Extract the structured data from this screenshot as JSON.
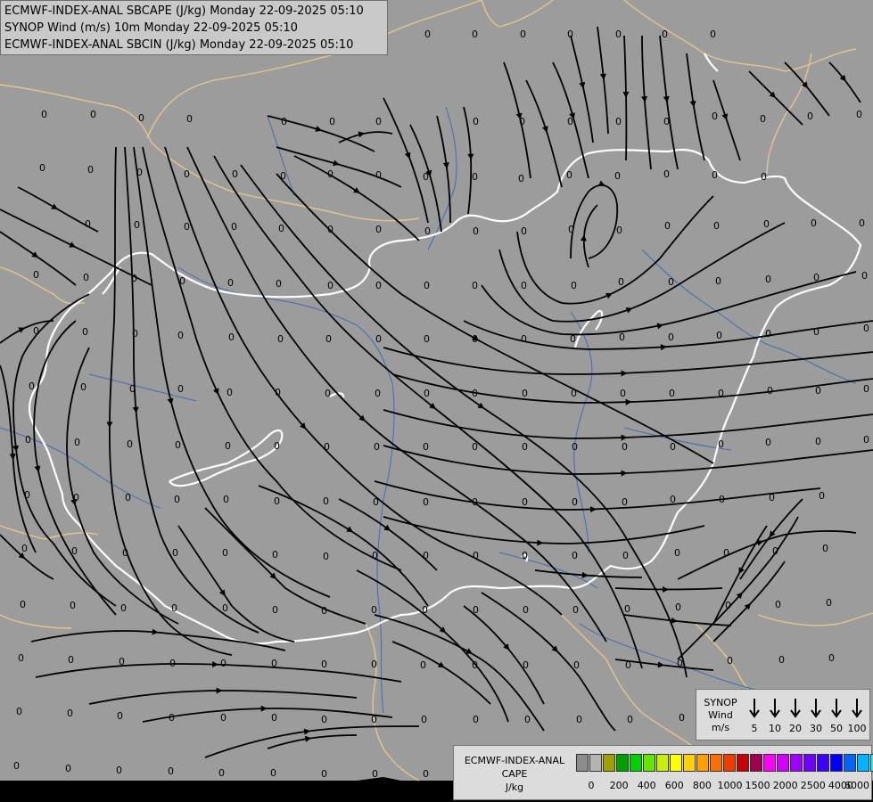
{
  "title_lines": [
    "ECMWF-INDEX-ANAL SBCAPE (J/kg) Monday 22-09-2025 05:10",
    "SYNOP Wind (m/s) 10m Monday 22-09-2025 05:10",
    "ECMWF-INDEX-ANAL SBCIN (J/kg) Monday 22-09-2025 05:10"
  ],
  "colors": {
    "background": "#9c9c9c",
    "streamline": "#000000",
    "national_border": "#ffffff",
    "regional_border": "#e5c58c",
    "rivers": "#3c6db4"
  },
  "station_value": "0",
  "stations": [
    [
      44,
      0
    ],
    [
      104,
      0
    ],
    [
      155,
      0
    ],
    [
      205,
      0
    ],
    [
      259,
      0
    ],
    [
      314,
      0
    ],
    [
      369,
      0
    ],
    [
      421,
      0
    ],
    [
      476,
      0
    ],
    [
      529,
      0
    ],
    [
      583,
      0
    ],
    [
      636,
      0
    ],
    [
      690,
      0
    ],
    [
      742,
      0
    ],
    [
      796,
      0
    ],
    [
      46,
      90
    ],
    [
      101,
      90
    ],
    [
      155,
      94
    ],
    [
      209,
      95
    ],
    [
      315,
      98
    ],
    [
      369,
      98
    ],
    [
      421,
      98
    ],
    [
      530,
      98
    ],
    [
      582,
      98
    ],
    [
      636,
      98
    ],
    [
      690,
      98
    ],
    [
      744,
      98
    ],
    [
      798,
      92
    ],
    [
      852,
      95
    ],
    [
      905,
      92
    ],
    [
      960,
      90
    ],
    [
      44,
      150
    ],
    [
      98,
      152
    ],
    [
      153,
      155
    ],
    [
      206,
      157
    ],
    [
      260,
      157
    ],
    [
      314,
      159
    ],
    [
      367,
      157
    ],
    [
      421,
      158
    ],
    [
      474,
      160
    ],
    [
      529,
      160
    ],
    [
      581,
      162
    ],
    [
      635,
      158
    ],
    [
      689,
      159
    ],
    [
      744,
      157
    ],
    [
      798,
      158
    ],
    [
      853,
      160
    ],
    [
      95,
      213
    ],
    [
      150,
      214
    ],
    [
      206,
      216
    ],
    [
      259,
      216
    ],
    [
      312,
      218
    ],
    [
      367,
      219
    ],
    [
      421,
      219
    ],
    [
      476,
      221
    ],
    [
      530,
      221
    ],
    [
      584,
      221
    ],
    [
      637,
      219
    ],
    [
      691,
      220
    ],
    [
      745,
      215
    ],
    [
      800,
      215
    ],
    [
      856,
      213
    ],
    [
      909,
      212
    ],
    [
      963,
      212
    ],
    [
      37,
      270
    ],
    [
      93,
      273
    ],
    [
      147,
      274
    ],
    [
      201,
      277
    ],
    [
      255,
      279
    ],
    [
      309,
      280
    ],
    [
      367,
      282
    ],
    [
      421,
      282
    ],
    [
      475,
      282
    ],
    [
      529,
      282
    ],
    [
      584,
      282
    ],
    [
      640,
      282
    ],
    [
      693,
      278
    ],
    [
      749,
      278
    ],
    [
      802,
      277
    ],
    [
      858,
      275
    ],
    [
      912,
      273
    ],
    [
      966,
      271
    ],
    [
      37,
      333
    ],
    [
      92,
      334
    ],
    [
      148,
      336
    ],
    [
      199,
      338
    ],
    [
      256,
      340
    ],
    [
      311,
      342
    ],
    [
      365,
      342
    ],
    [
      421,
      342
    ],
    [
      475,
      342
    ],
    [
      529,
      342
    ],
    [
      584,
      342
    ],
    [
      639,
      342
    ],
    [
      694,
      340
    ],
    [
      749,
      340
    ],
    [
      803,
      338
    ],
    [
      858,
      336
    ],
    [
      912,
      334
    ],
    [
      968,
      330
    ],
    [
      32,
      395
    ],
    [
      90,
      396
    ],
    [
      145,
      398
    ],
    [
      199,
      398
    ],
    [
      254,
      402
    ],
    [
      308,
      402
    ],
    [
      364,
      403
    ],
    [
      420,
      403
    ],
    [
      475,
      403
    ],
    [
      529,
      403
    ],
    [
      585,
      403
    ],
    [
      640,
      403
    ],
    [
      695,
      403
    ],
    [
      750,
      403
    ],
    [
      805,
      403
    ],
    [
      860,
      400
    ],
    [
      914,
      400
    ],
    [
      968,
      398
    ],
    [
      28,
      455
    ],
    [
      83,
      458
    ],
    [
      142,
      460
    ],
    [
      196,
      461
    ],
    [
      252,
      462
    ],
    [
      307,
      462
    ],
    [
      363,
      463
    ],
    [
      419,
      463
    ],
    [
      474,
      463
    ],
    [
      529,
      463
    ],
    [
      585,
      463
    ],
    [
      641,
      463
    ],
    [
      697,
      463
    ],
    [
      751,
      463
    ],
    [
      805,
      460
    ],
    [
      858,
      458
    ],
    [
      914,
      457
    ],
    [
      968,
      455
    ],
    [
      27,
      517
    ],
    [
      82,
      520
    ],
    [
      140,
      520
    ],
    [
      195,
      522
    ],
    [
      250,
      522
    ],
    [
      307,
      524
    ],
    [
      362,
      524
    ],
    [
      418,
      525
    ],
    [
      474,
      525
    ],
    [
      529,
      525
    ],
    [
      585,
      525
    ],
    [
      641,
      525
    ],
    [
      697,
      525
    ],
    [
      751,
      522
    ],
    [
      806,
      522
    ],
    [
      862,
      520
    ],
    [
      918,
      518
    ],
    [
      24,
      577
    ],
    [
      80,
      580
    ],
    [
      137,
      582
    ],
    [
      193,
      582
    ],
    [
      249,
      582
    ],
    [
      305,
      584
    ],
    [
      362,
      586
    ],
    [
      417,
      585
    ],
    [
      474,
      585
    ],
    [
      530,
      585
    ],
    [
      585,
      585
    ],
    [
      641,
      585
    ],
    [
      698,
      585
    ],
    [
      756,
      582
    ],
    [
      811,
      582
    ],
    [
      866,
      580
    ],
    [
      922,
      577
    ],
    [
      22,
      640
    ],
    [
      78,
      641
    ],
    [
      135,
      644
    ],
    [
      192,
      644
    ],
    [
      249,
      644
    ],
    [
      305,
      646
    ],
    [
      360,
      647
    ],
    [
      416,
      646
    ],
    [
      473,
      646
    ],
    [
      530,
      646
    ],
    [
      586,
      646
    ],
    [
      642,
      646
    ],
    [
      700,
      645
    ],
    [
      757,
      643
    ],
    [
      813,
      641
    ],
    [
      869,
      640
    ],
    [
      926,
      638
    ],
    [
      20,
      700
    ],
    [
      76,
      702
    ],
    [
      133,
      704
    ],
    [
      190,
      706
    ],
    [
      247,
      706
    ],
    [
      304,
      706
    ],
    [
      360,
      707
    ],
    [
      416,
      707
    ],
    [
      471,
      708
    ],
    [
      529,
      708
    ],
    [
      586,
      708
    ],
    [
      643,
      708
    ],
    [
      701,
      708
    ],
    [
      759,
      706
    ],
    [
      815,
      703
    ],
    [
      873,
      702
    ],
    [
      929,
      700
    ],
    [
      18,
      760
    ],
    [
      75,
      762
    ],
    [
      131,
      765
    ],
    [
      189,
      767
    ],
    [
      247,
      767
    ],
    [
      304,
      767
    ],
    [
      360,
      769
    ],
    [
      416,
      769
    ],
    [
      472,
      769
    ],
    [
      530,
      769
    ],
    [
      588,
      769
    ],
    [
      646,
      769
    ],
    [
      703,
      769
    ],
    [
      761,
      767
    ],
    [
      821,
      765
    ],
    [
      876,
      765
    ],
    [
      931,
      762
    ],
    [
      15,
      821
    ],
    [
      73,
      824
    ],
    [
      130,
      826
    ],
    [
      188,
      827
    ],
    [
      245,
      829
    ],
    [
      303,
      829
    ],
    [
      360,
      830
    ],
    [
      417,
      830
    ],
    [
      474,
      830
    ],
    [
      531,
      830
    ],
    [
      590,
      830
    ],
    [
      647,
      830
    ],
    [
      704,
      830
    ],
    [
      762,
      829
    ],
    [
      821,
      827
    ],
    [
      877,
      825
    ]
  ],
  "wind_legend": {
    "title_lines": [
      "SYNOP",
      "Wind",
      "m/s"
    ],
    "values": [
      "5",
      "10",
      "20",
      "30",
      "50",
      "100"
    ]
  },
  "cape_legend": {
    "title_lines": [
      "ECMWF-INDEX-ANAL",
      "CAPE",
      "J/kg"
    ],
    "colors": [
      "#8c8c8c",
      "#b4b4b4",
      "#a0a000",
      "#00a000",
      "#00d200",
      "#64e600",
      "#c8f000",
      "#ffff00",
      "#ffd200",
      "#ffa000",
      "#ff6e00",
      "#f03c00",
      "#c80000",
      "#a00050",
      "#ff00ff",
      "#d200ff",
      "#a000ff",
      "#6e00ff",
      "#3c00ff",
      "#0000ff",
      "#0064ff",
      "#00b4ff",
      "#00ffff",
      "#b4ffff",
      "#ffffff"
    ],
    "ticks": [
      "0",
      "200",
      "400",
      "600",
      "800",
      "1000",
      "1500",
      "2000",
      "2500",
      "4000",
      "6000"
    ]
  }
}
